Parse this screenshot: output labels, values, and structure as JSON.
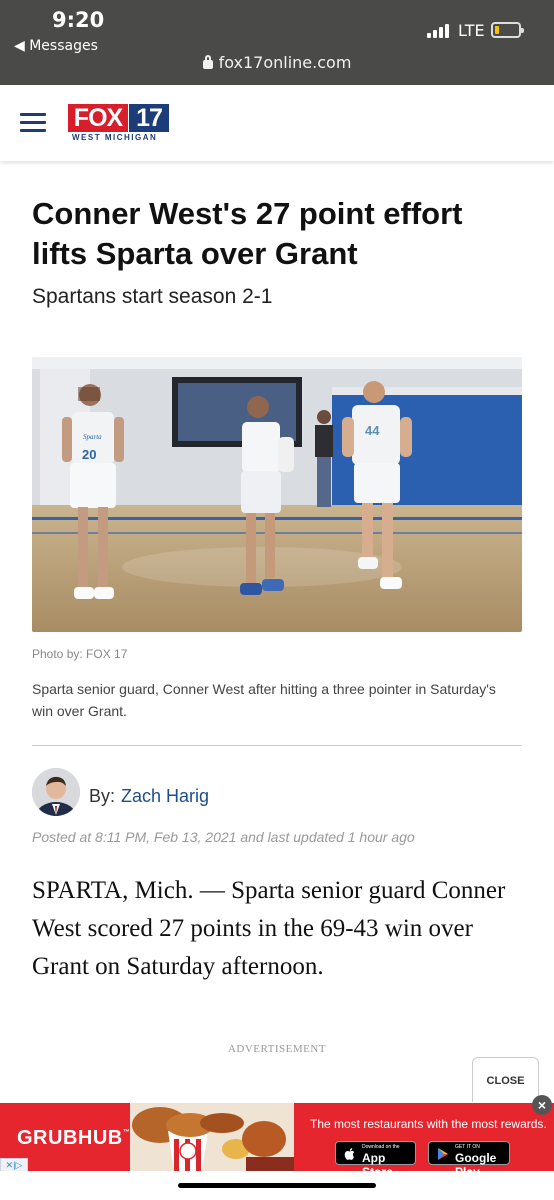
{
  "status_bar": {
    "time": "9:20",
    "back_label": "◀ Messages",
    "network": "LTE",
    "url": "fox17online.com"
  },
  "header": {
    "logo_brand": "FOX",
    "logo_number": "17",
    "logo_sub": "WEST MICHIGAN",
    "brand_red": "#d81e2a",
    "brand_blue": "#1c3d7a"
  },
  "article": {
    "headline": "Conner West's 27 point effort lifts Sparta over Grant",
    "subheadline": "Spartans start season 2-1",
    "photo_credit": "Photo by: FOX 17",
    "caption": "Sparta senior guard, Conner West after hitting a three pointer in Saturday's win over Grant.",
    "byline_prefix": "By:",
    "author": "Zach Harig",
    "posted": "Posted at 8:11 PM, Feb 13, 2021 and last updated 1 hour ago",
    "body": "SPARTA, Mich. — Sparta senior guard Conner West scored 27 points in the 69-43 win over Grant on Saturday afternoon.",
    "jersey_left": "20",
    "jersey_right": "44",
    "jersey_script": "Sparta"
  },
  "ad": {
    "label": "ADVERTISEMENT",
    "close_label": "CLOSE",
    "close_x": "×",
    "brand": "GRUBHUB",
    "tagline": "The most restaurants with the most rewards.",
    "appstore_small": "Download on the",
    "appstore_big": "App Store",
    "playstore_small": "GET IT ON",
    "playstore_big": "Google Play",
    "adchoices": "✕|▷"
  }
}
